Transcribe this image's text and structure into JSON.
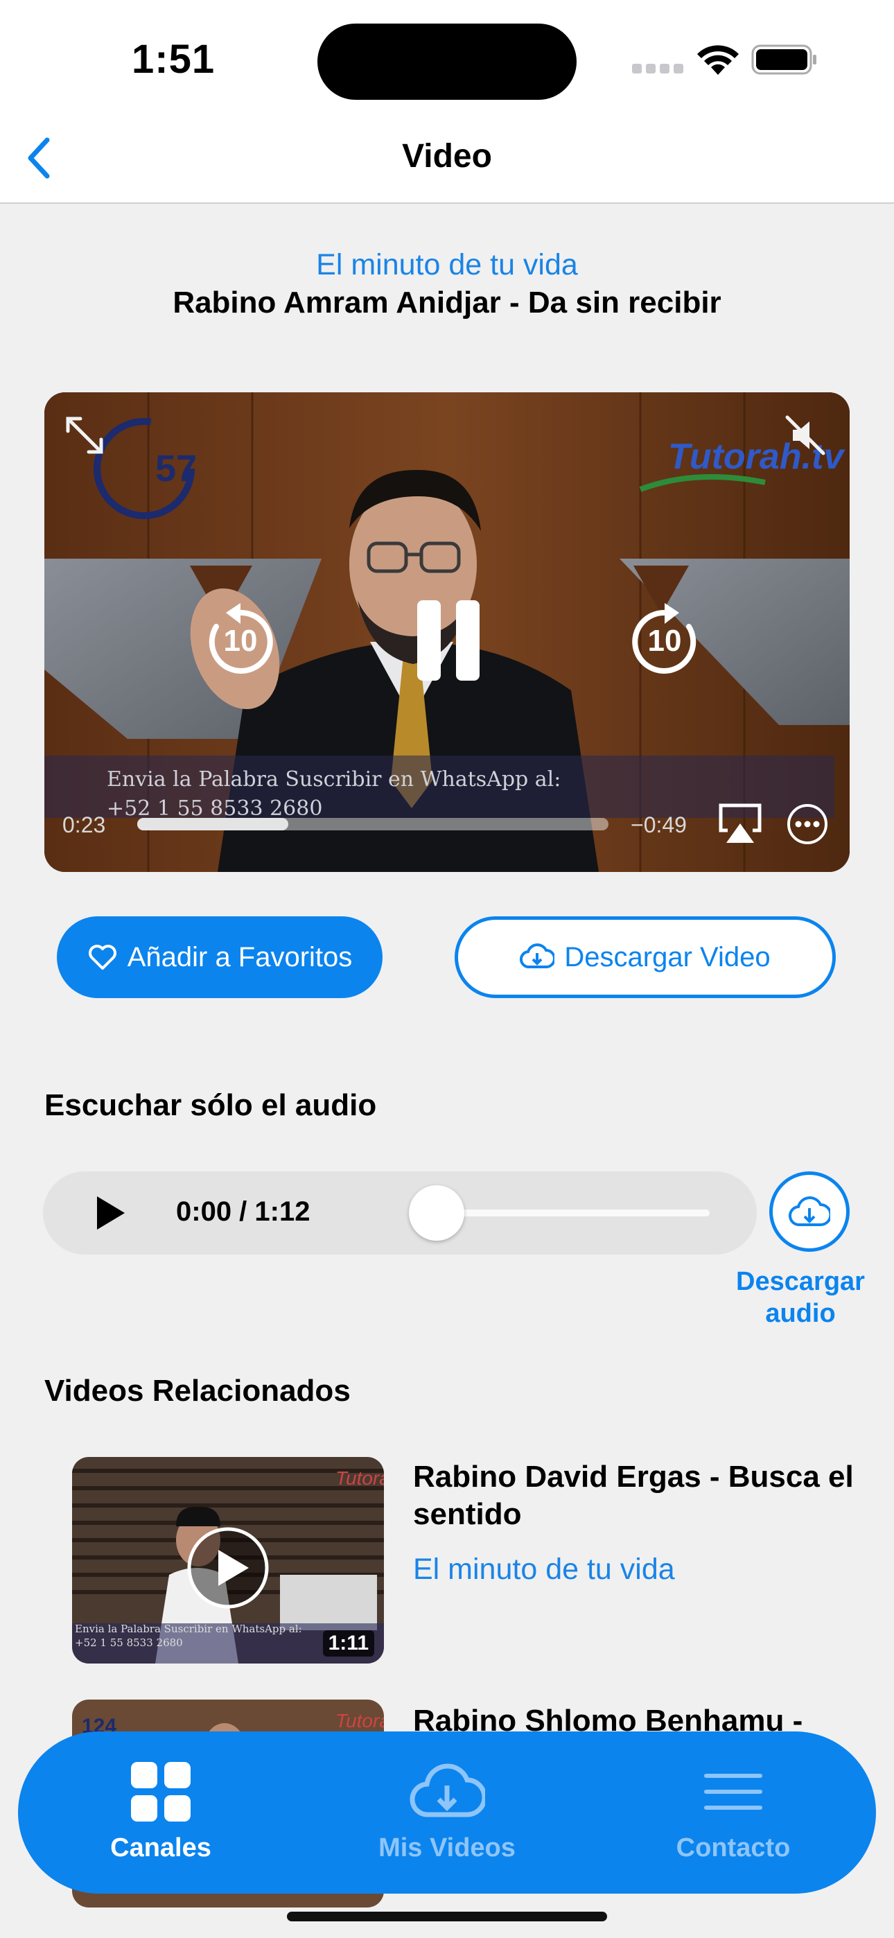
{
  "status_bar": {
    "time": "1:51"
  },
  "nav": {
    "title": "Video"
  },
  "video": {
    "channel": "El minuto de tu vida",
    "title": "Rabino Amram Anidjar - Da sin recibir",
    "current_time": "0:23",
    "remaining_time": "−0:49",
    "progress_fraction": 0.32,
    "overlay_line1": "Envia la Palabra Suscribir en WhatsApp al:",
    "overlay_line2": "+52 1 55 8533 2680",
    "skip_seconds": "10",
    "watermark": "Tutorah.tv",
    "logo_text": "57"
  },
  "actions": {
    "favorite_label": "Añadir a Favoritos",
    "download_label": "Descargar Video"
  },
  "audio": {
    "heading": "Escuchar sólo el audio",
    "time": "0:00 / 1:12",
    "progress_fraction": 0.0,
    "download_line1": "Descargar",
    "download_line2": "audio"
  },
  "related": {
    "heading": "Videos Relacionados",
    "items": [
      {
        "title": "Rabino David Ergas - Busca el sentido",
        "channel": "El minuto de tu vida",
        "duration": "1:11",
        "overlay_line1": "Envia la Palabra Suscribir en WhatsApp al:",
        "overlay_line2": "+52 1 55 8533 2680"
      },
      {
        "title": "Rabino Shlomo Benhamu -",
        "logo_text": "124"
      }
    ]
  },
  "tabs": [
    {
      "label": "Canales",
      "icon": "grid-icon",
      "active": true
    },
    {
      "label": "Mis Videos",
      "icon": "cloud-download-icon",
      "active": false
    },
    {
      "label": "Contacto",
      "icon": "menu-icon",
      "active": false
    }
  ],
  "colors": {
    "accent": "#0b84ee",
    "link": "#1a84e6",
    "background": "#f0f0f1",
    "inactive_tab": "#8ec5f8"
  }
}
